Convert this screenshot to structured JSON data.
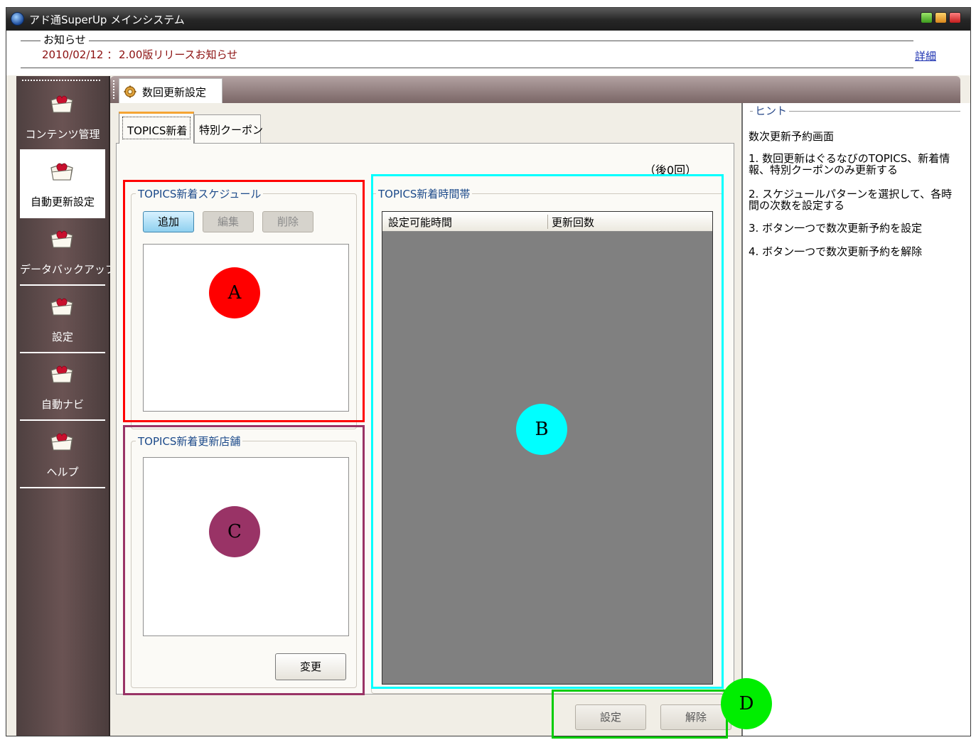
{
  "window": {
    "title": "アド通SuperUp メインシステム"
  },
  "notice": {
    "legend": "お知らせ",
    "date": "2010/02/12 ：",
    "message": "2.00版リリースお知らせ",
    "detail_link": "詳細"
  },
  "sidebar": {
    "items": [
      {
        "label": "コンテンツ管理",
        "icon": "heart-folder-icon",
        "active": false
      },
      {
        "label": "自動更新設定",
        "icon": "heart-folder-icon",
        "active": true
      },
      {
        "label": "データバックアップ",
        "icon": "heart-folder-icon",
        "active": false
      },
      {
        "label": "設定",
        "icon": "heart-folder-icon",
        "active": false
      },
      {
        "label": "自動ナビ",
        "icon": "heart-folder-icon",
        "active": false
      },
      {
        "label": "ヘルプ",
        "icon": "heart-folder-icon",
        "active": false
      }
    ]
  },
  "doc_tab": {
    "label": "数回更新設定"
  },
  "subtabs": [
    {
      "label": "TOPICS新着",
      "selected": true
    },
    {
      "label": "特別クーポン",
      "selected": false
    }
  ],
  "panel": {
    "remaining": "（後0回）",
    "schedule": {
      "title": "TOPICS新着スケジュール",
      "add_label": "追加",
      "edit_label": "編集",
      "delete_label": "削除"
    },
    "stores": {
      "title": "TOPICS新着更新店舗",
      "change_label": "変更"
    },
    "timeslots": {
      "title": "TOPICS新着時間帯",
      "columns": [
        "設定可能時間",
        "更新回数"
      ]
    }
  },
  "actions": {
    "set_label": "設定",
    "release_label": "解除"
  },
  "hint": {
    "title": "ヒント",
    "heading": "数次更新予約画面",
    "lines": [
      "1. 数回更新はぐるなびのTOPICS、新着情報、特別クーポンのみ更新する",
      "2. スケジュールパターンを選択して、各時間の次数を設定する",
      "3. ボタン一つで数次更新予約を設定",
      "4. ボタン一つで数次更新予約を解除"
    ]
  },
  "annotations": [
    {
      "letter": "A",
      "box_color": "#ff0000",
      "circle_color": "#ff0000"
    },
    {
      "letter": "B",
      "box_color": "#00ffff",
      "circle_color": "#00ffff"
    },
    {
      "letter": "C",
      "box_color": "#993366",
      "circle_color": "#993366"
    },
    {
      "letter": "D",
      "box_color": "#00cc00",
      "circle_color": "#00ee00"
    }
  ]
}
